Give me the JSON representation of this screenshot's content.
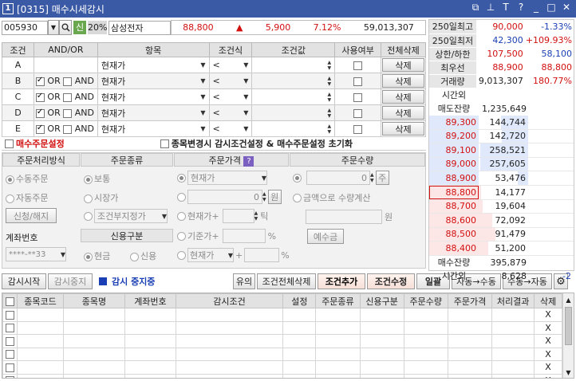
{
  "window": {
    "badge": "1",
    "title": "[0315] 매수시세감시"
  },
  "stock": {
    "code": "005930",
    "credit_badge": "신",
    "margin": "20%",
    "name": "삼성전자",
    "price": "88,800",
    "change": "5,900",
    "rate": "7.12%",
    "volume": "59,013,307"
  },
  "conditions": {
    "headers": [
      "조건",
      "AND/OR",
      "항목",
      "조건식",
      "조건값",
      "사용여부",
      "전체삭제"
    ],
    "or_label": "OR",
    "and_label": "AND",
    "rows": [
      {
        "id": "A",
        "item": "현재가",
        "op": "<",
        "delete": "삭제",
        "show_andor": false
      },
      {
        "id": "B",
        "item": "현재가",
        "op": "<",
        "delete": "삭제",
        "show_andor": true
      },
      {
        "id": "C",
        "item": "현재가",
        "op": "<",
        "delete": "삭제",
        "show_andor": true
      },
      {
        "id": "D",
        "item": "현재가",
        "op": "<",
        "delete": "삭제",
        "show_andor": true
      },
      {
        "id": "E",
        "item": "현재가",
        "op": "<",
        "delete": "삭제",
        "show_andor": true
      }
    ]
  },
  "settings": {
    "buy_order": "매수주문설정",
    "change_stock": "종목변경시 감시조건설정 & 매수주문설정 초기화"
  },
  "order": {
    "method_header": "주문처리방식",
    "type_header": "주문종류",
    "price_header": "주문가격",
    "qty_header": "주문수량",
    "manual": "수동주문",
    "auto": "자동주문",
    "register_btn": "신청/해지",
    "account_label": "계좌번호",
    "account_value": "****-**33",
    "normal": "보통",
    "market": "시장가",
    "conditional": "조건부지정가",
    "credit_header": "신용구분",
    "cash": "현금",
    "credit": "신용",
    "price_current": "현재가",
    "price_zero": "0",
    "won": "원",
    "tick_label": "현재가+",
    "tick_unit": "틱",
    "base_label": "기준가+",
    "percent": "%",
    "sel_current": "현재가",
    "qty_zero": "0",
    "share_unit": "주",
    "amount_calc": "금액으로 수량계산",
    "amount_won": "원",
    "deposit_btn": "예수금"
  },
  "toolbar": {
    "start": "감시시작",
    "stop": "감시중지",
    "status": "감시 중지중",
    "caution": "유의",
    "delete_all": "조건전체삭제",
    "add": "조건추가",
    "edit": "조건수정",
    "bulk": "일괄",
    "auto_to_manual": "자동→수동",
    "manual_to_auto": "수동→자동"
  },
  "grid": {
    "headers": [
      "종목코드",
      "종목명",
      "계좌번호",
      "감시조건",
      "설정",
      "주문종류",
      "신용구분",
      "주문수량",
      "주문가격",
      "처리결과",
      "삭제"
    ],
    "delete_mark": "X",
    "rows": 6
  },
  "quote": {
    "stats": [
      {
        "label": "250일최고",
        "v1": "90,000",
        "v2": "-1.33%",
        "c1": "red",
        "c2": "blue"
      },
      {
        "label": "250일최저",
        "v1": "42,300",
        "v2": "+109.93%",
        "c1": "blue",
        "c2": "red"
      },
      {
        "label": "상한/하한",
        "v1": "107,500",
        "v2": "58,100",
        "c1": "red",
        "c2": "blue"
      },
      {
        "label": "최우선",
        "v1": "88,900",
        "v2": "88,800",
        "c1": "red",
        "c2": "red"
      },
      {
        "label": "거래량",
        "v1": "9,013,307",
        "v2": "180.77%",
        "c1": "",
        "c2": "red"
      }
    ],
    "after_hours_label": "시간외",
    "ask_total_label": "매도잔량",
    "ask_total": "1,235,649",
    "asks": [
      {
        "price": "89,300",
        "qty": "144,744",
        "bar": 0.56
      },
      {
        "price": "89,200",
        "qty": "142,720",
        "bar": 0.55
      },
      {
        "price": "89,100",
        "qty": "258,521",
        "bar": 1.0
      },
      {
        "price": "89,000",
        "qty": "257,605",
        "bar": 1.0
      },
      {
        "price": "88,900",
        "qty": "53,476",
        "bar": 0.21
      }
    ],
    "bids": [
      {
        "price": "88,800",
        "qty": "14,177",
        "bar": 0.05
      },
      {
        "price": "88,700",
        "qty": "19,604",
        "bar": 0.08
      },
      {
        "price": "88,600",
        "qty": "72,092",
        "bar": 0.28
      },
      {
        "price": "88,500",
        "qty": "91,479",
        "bar": 0.35
      },
      {
        "price": "88,400",
        "qty": "51,200",
        "bar": 0.2
      }
    ],
    "bid_total_label": "매수잔량",
    "bid_total": "395,879",
    "after_label": "시간외",
    "after_value": "8,628",
    "after_change": "-2"
  },
  "colors": {
    "title_bar": "#3b5aa6",
    "up": "#d21010",
    "down": "#1a3fb4",
    "ask_bg": "#dfe9fb",
    "bid_bg": "#fde6e6"
  }
}
